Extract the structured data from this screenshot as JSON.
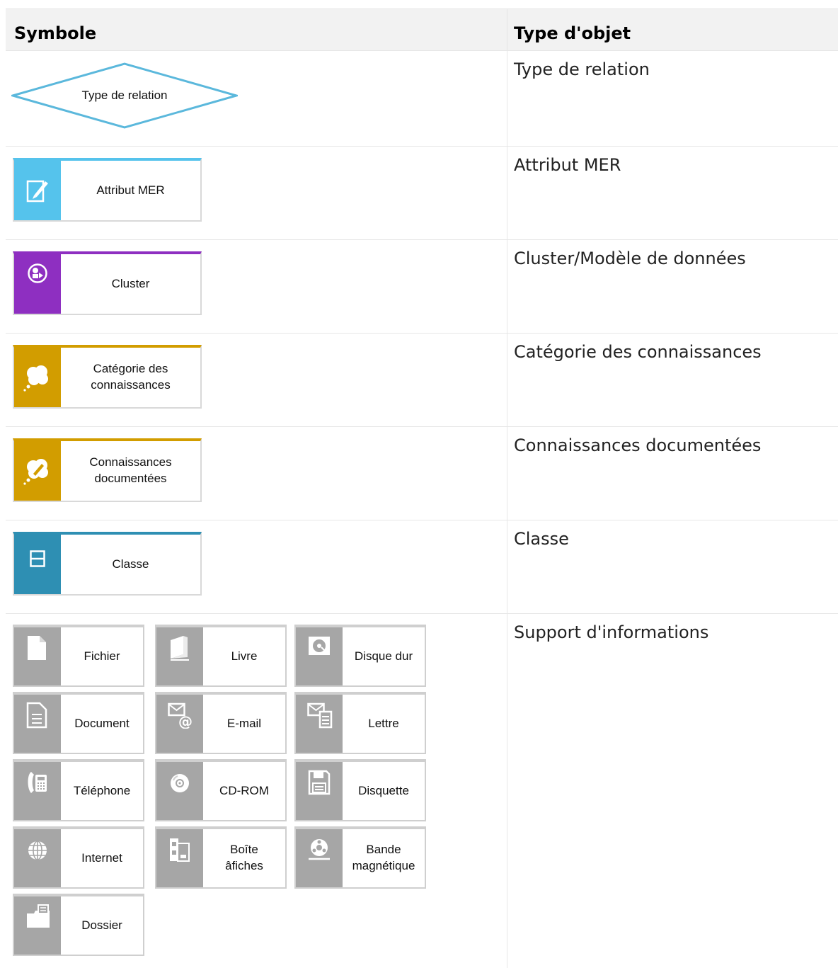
{
  "table": {
    "headers": {
      "symbol": "Symbole",
      "type": "Type d'objet"
    },
    "rows": [
      {
        "type": "Type de relation",
        "symbol_label": "Type de relation",
        "color": "#5bb8dc"
      },
      {
        "type": "Attribut MER",
        "symbol_label": "Attribut MER",
        "color": "#55c3ec",
        "icon": "pen-document-icon"
      },
      {
        "type": "Cluster/Modèle de données",
        "symbol_label": "Cluster",
        "color": "#8e2fc1",
        "icon": "cluster-icon"
      },
      {
        "type": "Catégorie des connaissances",
        "symbol_label": "Catégorie des\nconnaissances",
        "color": "#d29d00",
        "icon": "thought-cloud-icon"
      },
      {
        "type": "Connaissances documentées",
        "symbol_label": "Connaissances\ndocumentées",
        "color": "#d29d00",
        "icon": "thought-cloud-pen-icon"
      },
      {
        "type": "Classe",
        "symbol_label": "Classe",
        "color": "#2e8fb3",
        "icon": "class-icon"
      },
      {
        "type": "Support d'informations",
        "carriers": [
          {
            "label": "Fichier",
            "icon": "file-icon"
          },
          {
            "label": "Livre",
            "icon": "book-icon"
          },
          {
            "label": "Disque dur",
            "icon": "hard-disk-icon"
          },
          {
            "label": "Document",
            "icon": "document-icon"
          },
          {
            "label": "E-mail",
            "icon": "email-icon"
          },
          {
            "label": "Lettre",
            "icon": "letter-icon"
          },
          {
            "label": "Téléphone",
            "icon": "telephone-icon"
          },
          {
            "label": "CD-ROM",
            "icon": "cd-rom-icon"
          },
          {
            "label": "Disquette",
            "icon": "floppy-disk-icon"
          },
          {
            "label": "Internet",
            "icon": "globe-icon"
          },
          {
            "label": "Boîte\nâfiches",
            "icon": "card-box-icon"
          },
          {
            "label": "Bande\nmagnétique",
            "icon": "magnetic-tape-icon"
          },
          {
            "label": "Dossier",
            "icon": "folder-icon"
          }
        ],
        "carrier_color": "#a6a6a6"
      }
    ]
  }
}
